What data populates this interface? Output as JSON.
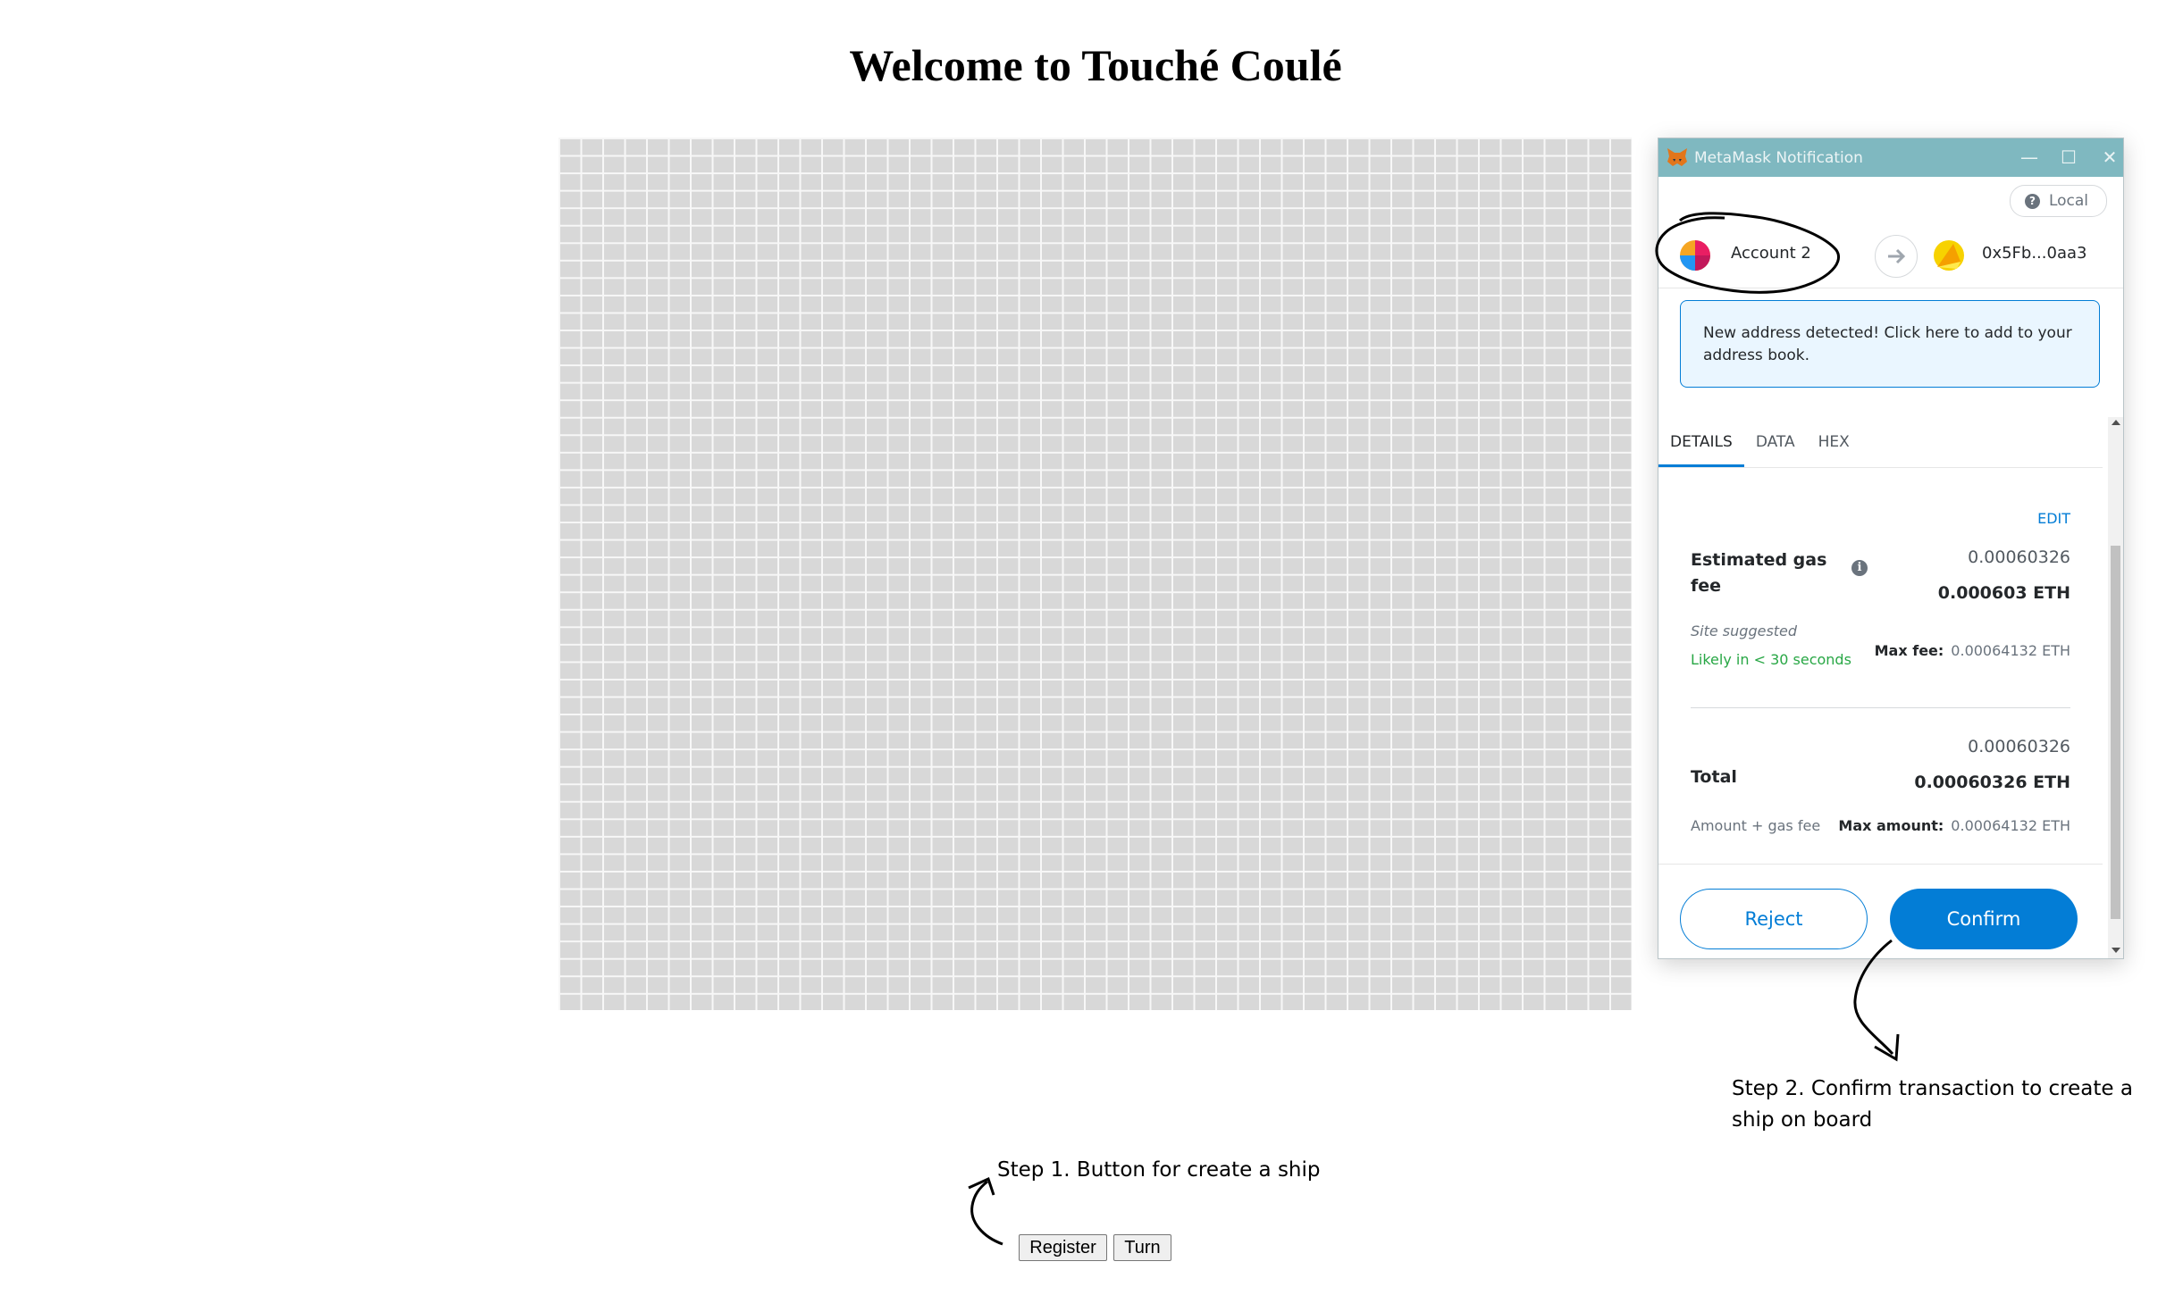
{
  "page": {
    "title": "Welcome to Touché Coulé",
    "buttons": {
      "register": "Register",
      "turn": "Turn"
    }
  },
  "annotations": {
    "step1": "Step 1. Button for create a ship",
    "step2": "Step 2. Confirm transaction to create a ship on board"
  },
  "metamask": {
    "window_title": "MetaMask Notification",
    "network": "Local",
    "from_account": "Account 2",
    "to_address": "0x5Fb...0aa3",
    "notice": "New address detected! Click here to add to your address book.",
    "tabs": [
      "DETAILS",
      "DATA",
      "HEX"
    ],
    "active_tab": "DETAILS",
    "edit_label": "EDIT",
    "gas": {
      "label": "Estimated gas fee",
      "value_secondary": "0.00060326",
      "value_primary": "0.000603 ETH",
      "site_suggested": "Site suggested",
      "likely": "Likely in < 30 seconds",
      "max_fee_label": "Max fee:",
      "max_fee_value": "0.00064132 ETH"
    },
    "total": {
      "label": "Total",
      "value_secondary": "0.00060326",
      "value_primary": "0.00060326 ETH",
      "amount_gas": "Amount + gas fee",
      "max_amount_label": "Max amount:",
      "max_amount_value": "0.00064132 ETH"
    },
    "reject_label": "Reject",
    "confirm_label": "Confirm"
  },
  "colors": {
    "accent": "#037dd6",
    "titlebar": "#7fb8c0",
    "success": "#28a745",
    "board_cell": "#d8d8d8"
  }
}
